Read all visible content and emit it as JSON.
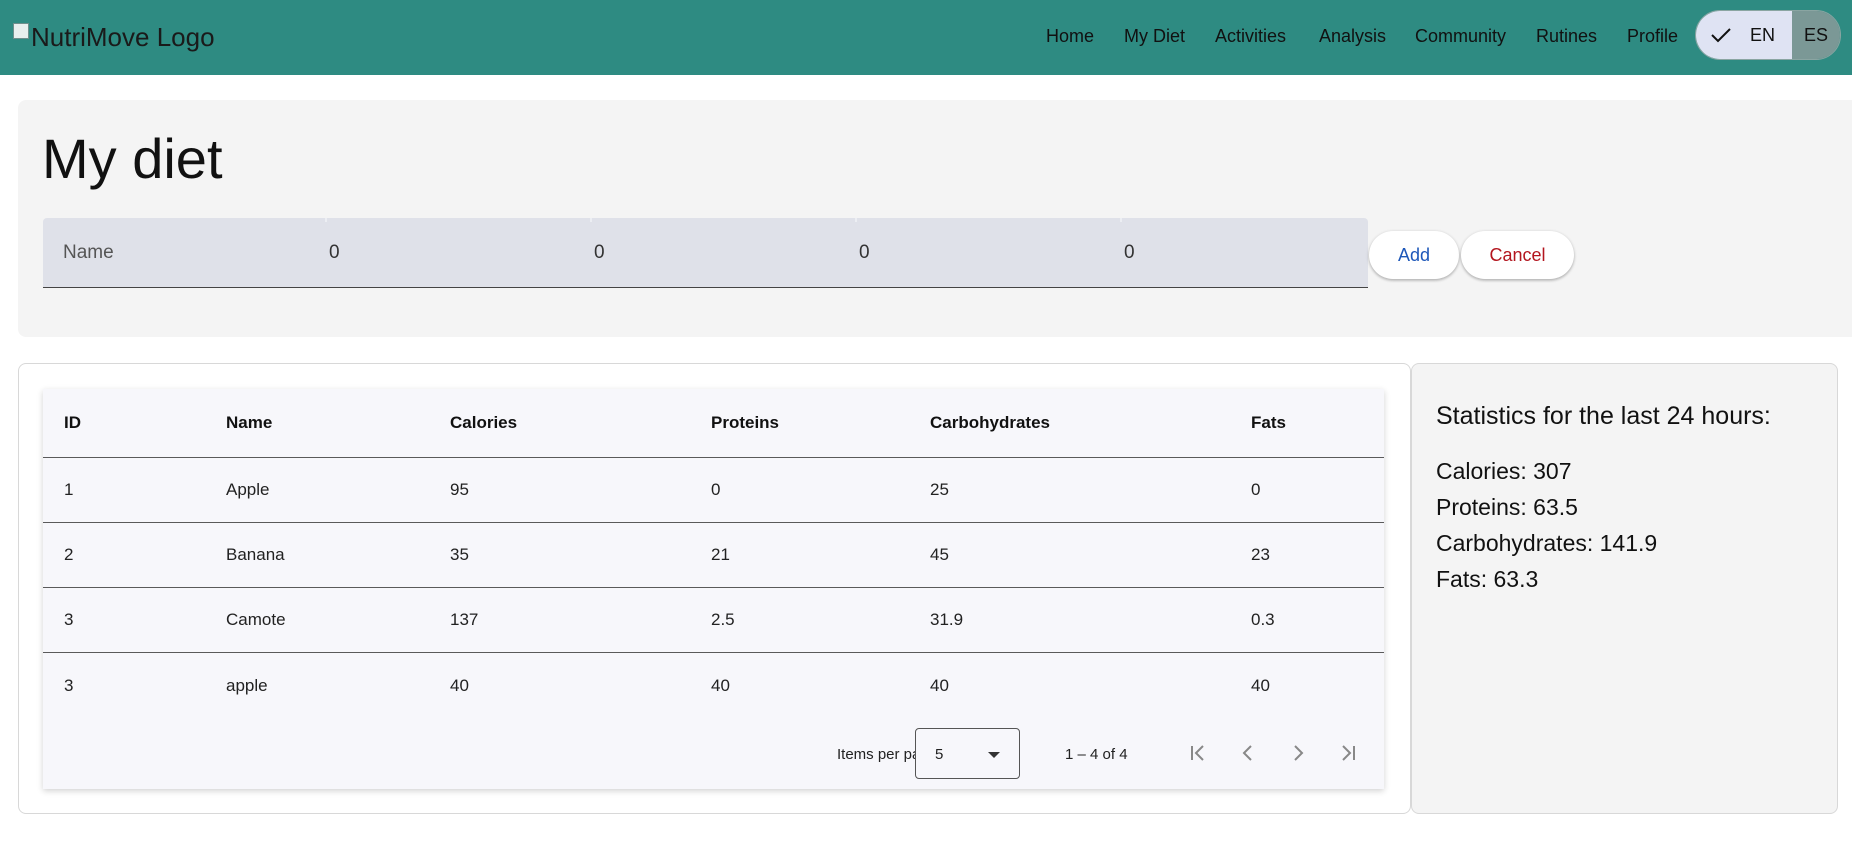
{
  "header": {
    "logo_alt": "NutriMove Logo",
    "nav": [
      "Home",
      "My Diet",
      "Activities",
      "Analysis",
      "Community",
      "Rutines",
      "Profile"
    ],
    "lang_en": "EN",
    "lang_es": "ES",
    "brand_color": "#2e8b82"
  },
  "form": {
    "title": "My diet",
    "name_placeholder": "Name",
    "calories": "0",
    "proteins": "0",
    "carbohydrates": "0",
    "fats": "0",
    "add_label": "Add",
    "cancel_label": "Cancel"
  },
  "table": {
    "headers": [
      "ID",
      "Name",
      "Calories",
      "Proteins",
      "Carbohydrates",
      "Fats"
    ],
    "rows": [
      [
        "1",
        "Apple",
        "95",
        "0",
        "25",
        "0"
      ],
      [
        "2",
        "Banana",
        "35",
        "21",
        "45",
        "23"
      ],
      [
        "3",
        "Camote",
        "137",
        "2.5",
        "31.9",
        "0.3"
      ],
      [
        "3",
        "apple",
        "40",
        "40",
        "40",
        "40"
      ]
    ]
  },
  "paginator": {
    "items_per_page_label": "Items per page:",
    "items_per_page": "5",
    "range": "1 – 4 of 4"
  },
  "stats": {
    "title": "Statistics for the last 24 hours:",
    "calories": "Calories: 307",
    "proteins": "Proteins: 63.5",
    "carbohydrates": "Carbohydrates: 141.9",
    "fats": "Fats: 63.3"
  }
}
